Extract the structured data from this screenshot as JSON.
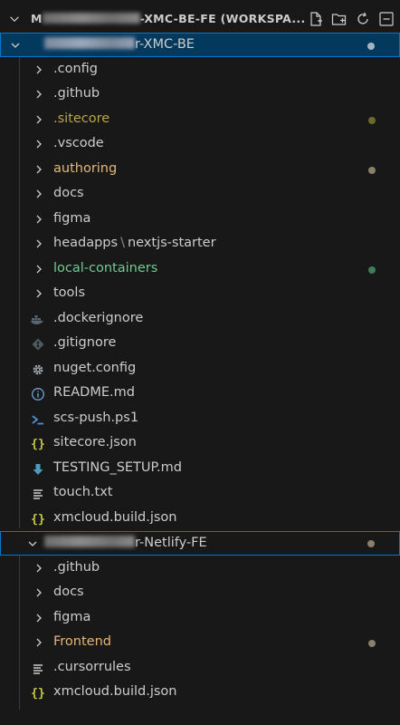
{
  "workspace": {
    "title_prefix": "M",
    "title_suffix": "-XMC-BE-FE (WORKSPA..."
  },
  "toolbar": {
    "new_file": "new-file-icon",
    "new_folder": "new-folder-icon",
    "refresh": "refresh-icon",
    "collapse": "collapse-all-icon"
  },
  "roots": [
    {
      "name_suffix": "r-XMC-BE"
    },
    {
      "name_suffix": "r-Netlify-FE"
    }
  ],
  "items": [
    {
      "label": ".config"
    },
    {
      "label": ".github"
    },
    {
      "label": ".sitecore"
    },
    {
      "label": ".vscode"
    },
    {
      "label": "authoring"
    },
    {
      "label": "docs"
    },
    {
      "label": "figma"
    },
    {
      "label": "headapps",
      "label2": "nextjs-starter",
      "sep": "\\"
    },
    {
      "label": "local-containers"
    },
    {
      "label": "tools"
    },
    {
      "label": ".dockerignore"
    },
    {
      "label": ".gitignore"
    },
    {
      "label": "nuget.config"
    },
    {
      "label": "README.md"
    },
    {
      "label": "scs-push.ps1"
    },
    {
      "label": "sitecore.json"
    },
    {
      "label": "TESTING_SETUP.md"
    },
    {
      "label": "touch.txt"
    },
    {
      "label": "xmcloud.build.json"
    },
    {
      "label": ".github"
    },
    {
      "label": "docs"
    },
    {
      "label": "figma"
    },
    {
      "label": "Frontend"
    },
    {
      "label": ".cursorrules"
    },
    {
      "label": "xmcloud.build.json"
    }
  ],
  "colors": {
    "selected_bg": "#04395e",
    "focus_border": "#0078d4",
    "modified": "#c39a53",
    "modified_dim": "#827e4a",
    "untracked": "#73c991",
    "dot_grey": "#8a7f6a",
    "dot_green": "#3f7d57",
    "dot_olive": "#6e6a2c"
  }
}
